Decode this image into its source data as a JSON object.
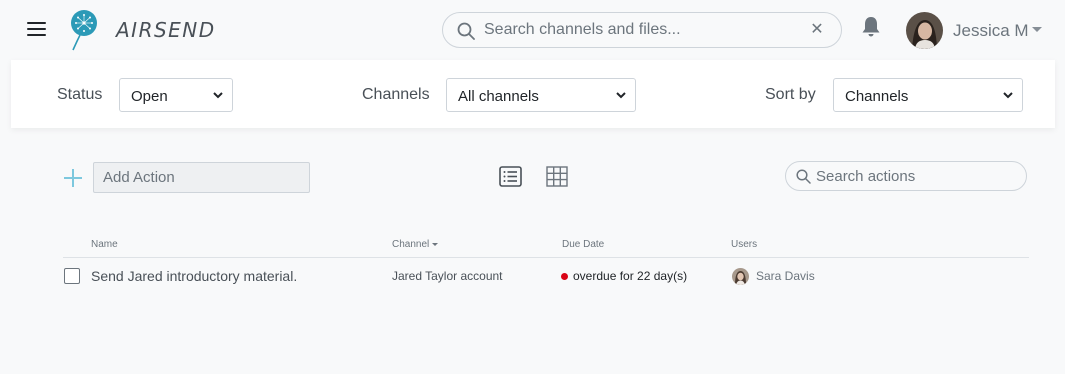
{
  "app": {
    "brand": "AIRSEND",
    "accent": "#2c9ab7"
  },
  "header": {
    "search_placeholder": "Search channels and files...",
    "user_name": "Jessica M"
  },
  "filters": {
    "status_label": "Status",
    "status_value": "Open",
    "channels_label": "Channels",
    "channels_value": "All channels",
    "sort_label": "Sort by",
    "sort_value": "Channels"
  },
  "toolbar": {
    "add_action_placeholder": "Add Action",
    "search_actions_placeholder": "Search actions"
  },
  "table": {
    "columns": [
      "Name",
      "Channel",
      "Due Date",
      "Users"
    ],
    "rows": [
      {
        "name": "Send Jared introductory material.",
        "channel": "Jared Taylor account",
        "due": "overdue for 22 day(s)",
        "due_status_color": "#d90416",
        "user": "Sara Davis"
      }
    ]
  }
}
